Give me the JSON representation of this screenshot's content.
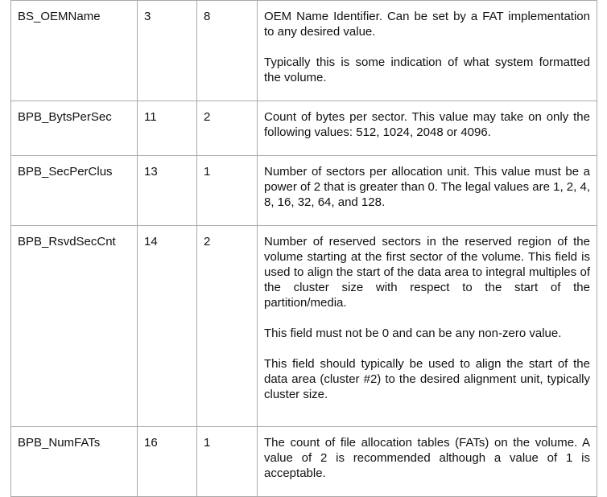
{
  "rows": [
    {
      "name": "BS_OEMName",
      "offset": "3",
      "size": "8",
      "description": [
        "OEM Name Identifier. Can be set by a FAT implementation to any desired value.",
        "Typically this is some indication of what system formatted the volume."
      ]
    },
    {
      "name": "BPB_BytsPerSec",
      "offset": "11",
      "size": "2",
      "description": [
        "Count of bytes per sector. This value may take on only the following values: 512, 1024, 2048 or 4096."
      ]
    },
    {
      "name": "BPB_SecPerClus",
      "offset": "13",
      "size": "1",
      "description": [
        "Number of sectors per allocation unit. This value must be a power of 2 that is greater than 0. The legal values are 1, 2, 4, 8, 16, 32, 64, and 128."
      ]
    },
    {
      "name": "BPB_RsvdSecCnt",
      "offset": "14",
      "size": "2",
      "description": [
        "Number of reserved sectors in the reserved region of the volume starting at the first sector of the volume. This field is used to align the start of the data area to integral multiples of the cluster size with respect to the start of the partition/media.",
        "This field must not be 0 and can be any non-zero value.",
        "This field should typically be used to align the start of the data area (cluster #2) to the desired alignment unit, typically cluster size."
      ]
    },
    {
      "name": "BPB_NumFATs",
      "offset": "16",
      "size": "1",
      "description": [
        "The count of file allocation tables (FATs) on the volume. A value of 2 is recommended although a value of 1 is acceptable."
      ]
    }
  ]
}
